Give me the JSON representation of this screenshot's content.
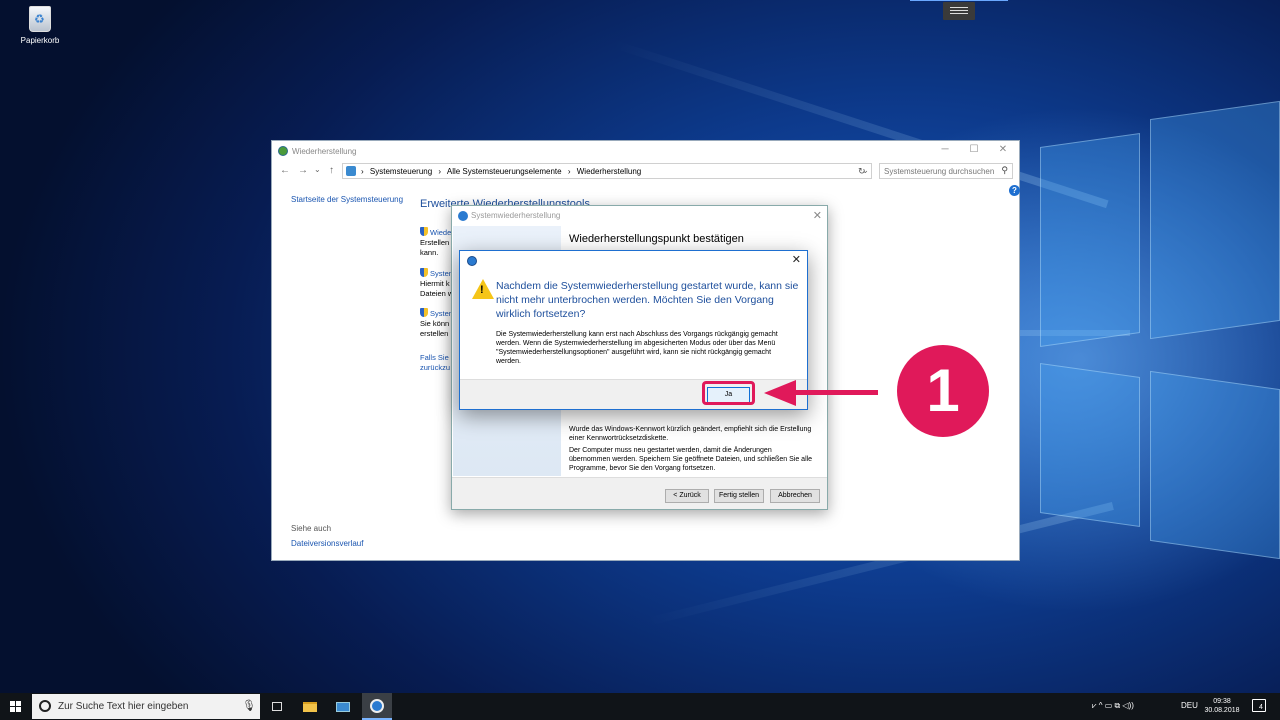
{
  "desktop": {
    "recycle_bin_label": "Papierkorb"
  },
  "control_panel": {
    "title": "Wiederherstellung",
    "window_buttons": {
      "minimize": "─",
      "maximize": "☐",
      "close": "✕"
    },
    "nav": {
      "back": "←",
      "forward": "→",
      "dropdown": "⌄",
      "up": "↑"
    },
    "breadcrumbs": [
      "Systemsteuerung",
      "›",
      "Alle Systemsteuerungselemente",
      "›",
      "Wiederherstellung"
    ],
    "breadcrumb_lead": "›",
    "address_dropdown": "⌄",
    "refresh": "↻",
    "search_placeholder": "Systemsteuerung durchsuchen",
    "search_icon": "⚲",
    "help": "?",
    "sidebar_link": "Startseite der Systemsteuerung",
    "heading": "Erweiterte Wiederherstellungstools",
    "items": [
      {
        "link": "Wiederherstellungslaufwerk erstellen",
        "line1": "Erstellen",
        "line2": "kann."
      },
      {
        "link": "Systemwiederherstellung öffnen",
        "line1": "Hiermit k",
        "line2": "Dateien w"
      },
      {
        "link": "Systemwiederherstellung konfigurieren",
        "line1": "Sie könn",
        "line2": "erstellen"
      }
    ],
    "falls_link_1": "Falls Sie P",
    "falls_link_2": "zurückzu",
    "see_also": "Siehe auch",
    "file_history_link": "Dateiversionsverlauf"
  },
  "restore_dialog": {
    "title": "Systemwiederherstellung",
    "close": "✕",
    "heading": "Wiederherstellungspunkt bestätigen",
    "text_1": "Wurde das Windows-Kennwort kürzlich geändert, empfiehlt sich die Erstellung einer Kennwortrücksetzdiskette.",
    "text_2": "Der Computer muss neu gestartet werden, damit die Änderungen übernommen werden. Speichern Sie geöffnete Dateien, und schließen Sie alle Programme, bevor Sie den Vorgang fortsetzen.",
    "buttons": {
      "back": "< Zurück",
      "finish": "Fertig stellen",
      "cancel": "Abbrechen"
    }
  },
  "confirm_dialog": {
    "close": "✕",
    "warning_mark": "!",
    "main_text": "Nachdem die Systemwiederherstellung gestartet wurde, kann sie nicht mehr unterbrochen werden. Möchten Sie den Vorgang wirklich fortsetzen?",
    "sub_text": "Die Systemwiederherstellung kann erst nach Abschluss des Vorgangs rückgängig gemacht werden. Wenn die Systemwiederherstellung im abgesicherten Modus oder über das Menü \"Systemwiederherstellungsoptionen\" ausgeführt wird, kann sie nicht rückgängig gemacht werden.",
    "yes_button": "Ja"
  },
  "annotation": {
    "step_number": "1",
    "color": "#e0195a"
  },
  "taskbar": {
    "search_placeholder": "Zur Suche Text hier eingeben",
    "mic": "🎙",
    "tray_icons": "⩗  ^  ▭  ⧉  ◁))",
    "language": "DEU",
    "time": "09:38",
    "date": "30.08.2018",
    "notification_count": "4"
  }
}
